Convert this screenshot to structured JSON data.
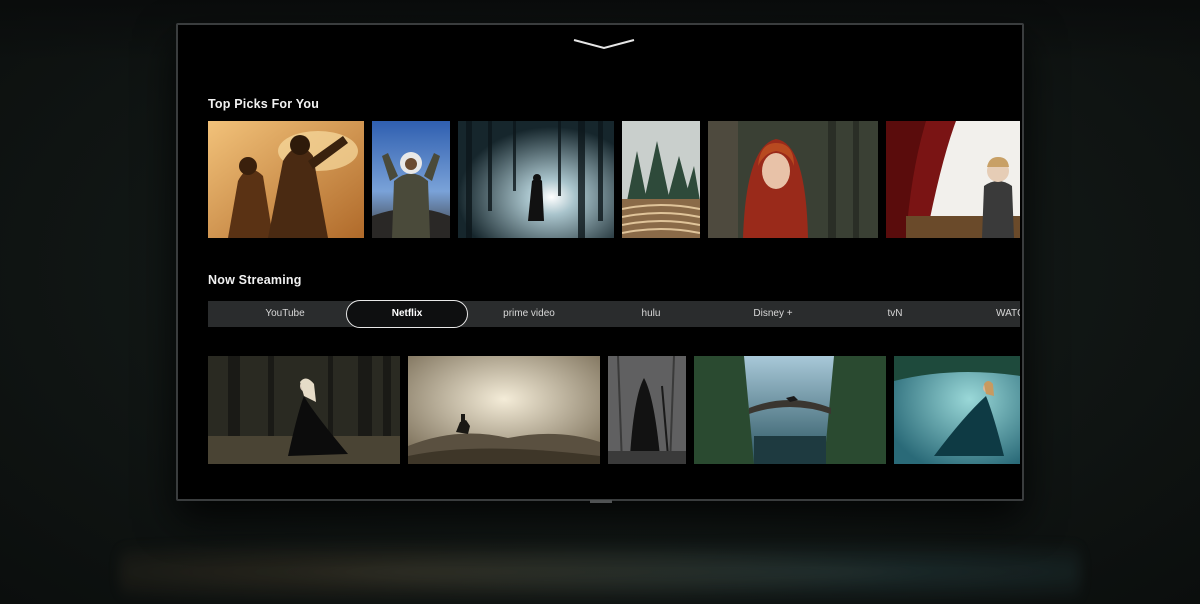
{
  "sections": {
    "top_picks_title": "Top Picks For You",
    "now_streaming_title": "Now Streaming"
  },
  "top_picks": [
    {
      "name": "pick-desert-couple"
    },
    {
      "name": "pick-astronaut"
    },
    {
      "name": "pick-foggy-forest-light"
    },
    {
      "name": "pick-maze-forest"
    },
    {
      "name": "pick-red-hood-girl"
    },
    {
      "name": "pick-theater-girl"
    }
  ],
  "streaming_tabs": [
    {
      "label": "YouTube",
      "selected": false
    },
    {
      "label": "Netflix",
      "selected": true
    },
    {
      "label": "prime video",
      "selected": false
    },
    {
      "label": "hulu",
      "selected": false
    },
    {
      "label": "Disney +",
      "selected": false
    },
    {
      "label": "tvN",
      "selected": false
    },
    {
      "label": "WATCHA",
      "selected": false
    }
  ],
  "streaming_tiles": [
    {
      "name": "stream-dark-forest-woman"
    },
    {
      "name": "stream-rider-hills"
    },
    {
      "name": "stream-hooded-figure"
    },
    {
      "name": "stream-canyon-bridge"
    },
    {
      "name": "stream-blue-forest-gown"
    }
  ],
  "colors": {
    "background": "#000000",
    "tab_bar": "#2a2c2d",
    "selected_outline": "#e8e8e8"
  }
}
